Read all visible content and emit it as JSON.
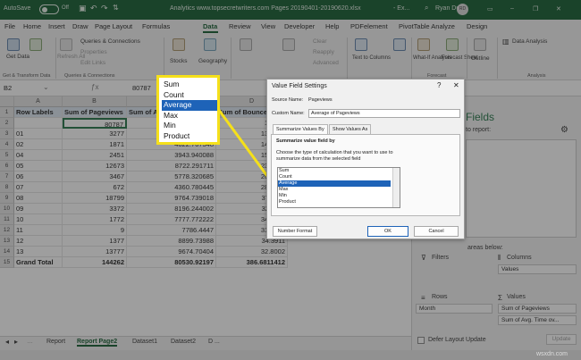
{
  "titlebar": {
    "autosave": "AutoSave",
    "toggle": "Off",
    "filename": "Analytics www.topsecretwriters.com Pages 20190401-20190620.xlsx",
    "suffix": "- Ex...",
    "user": "Ryan Dube",
    "initials": "RD"
  },
  "menu": [
    "File",
    "Home",
    "Insert",
    "Draw",
    "Page Layout",
    "Formulas",
    "Data",
    "Review",
    "View",
    "Developer",
    "Help",
    "PDFelement",
    "PivotTable Analyze",
    "Design"
  ],
  "ribbon": {
    "get_data": "Get Data",
    "refresh_all": "Refresh All",
    "queries_connections": "Queries & Connections",
    "properties": "Properties",
    "edit_links": "Edit Links",
    "stocks": "Stocks",
    "geography": "Geography",
    "clear": "Clear",
    "reapply": "Reapply",
    "advanced": "Advanced",
    "sort_filter": "Sort & Filter",
    "text_to_columns": "Text to Columns",
    "what_if": "What-If Analysis",
    "forecast_sheet": "Forecast Sheet",
    "outline": "Outline",
    "data_analysis": "Data Analysis",
    "group_get_transform": "Get & Transform Data",
    "group_queries": "Queries & Connections",
    "group_forecast": "Forecast",
    "group_analysis": "Analysis"
  },
  "formula_bar": {
    "name_box": "B2",
    "value": "80787"
  },
  "grid": {
    "columns": [
      "A",
      "B",
      "C",
      "D"
    ],
    "headers": [
      "Row Labels",
      "Sum of Pageviews",
      "Sum of A",
      "Sum of Bounce"
    ],
    "rows": [
      {
        "n": "2",
        "a": "",
        "b": "80787",
        "c": "",
        "d": "1.5578"
      },
      {
        "n": "3",
        "a": "01",
        "b": "3277",
        "c": "",
        "d": "13.5977"
      },
      {
        "n": "4",
        "a": "02",
        "b": "1871",
        "c": "4622.767348",
        "d": "14.6046"
      },
      {
        "n": "5",
        "a": "04",
        "b": "2451",
        "c": "3943.940088",
        "d": "15.3900"
      },
      {
        "n": "6",
        "a": "05",
        "b": "12673",
        "c": "8722.291711",
        "d": "23.7100"
      },
      {
        "n": "7",
        "a": "06",
        "b": "3467",
        "c": "5778.320685",
        "d": "26.0077"
      },
      {
        "n": "8",
        "a": "07",
        "b": "672",
        "c": "4360.780445",
        "d": "28.5510"
      },
      {
        "n": "9",
        "a": "08",
        "b": "18799",
        "c": "9764.739018",
        "d": "37.3911"
      },
      {
        "n": "10",
        "a": "09",
        "b": "3372",
        "c": "8196.244002",
        "d": "32.7811"
      },
      {
        "n": "11",
        "a": "10",
        "b": "1772",
        "c": "7777.772222",
        "d": "34.5822"
      },
      {
        "n": "12",
        "a": "11",
        "b": "9",
        "c": "7786.4447",
        "d": "31.6000"
      },
      {
        "n": "13",
        "a": "12",
        "b": "1377",
        "c": "8899.73988",
        "d": "34.3911"
      },
      {
        "n": "14",
        "a": "13",
        "b": "13777",
        "c": "9674.70404",
        "d": "32.8002"
      },
      {
        "n": "15",
        "a": "Grand Total",
        "b": "144262",
        "c": "80530.92197",
        "d": "386.6811412"
      }
    ]
  },
  "sheet_tabs": [
    "Report",
    "Report Page2",
    "Dataset1",
    "Dataset2",
    "D ..."
  ],
  "callout": {
    "items": [
      "Sum",
      "Count",
      "Average",
      "Max",
      "Min",
      "Product"
    ],
    "selected": "Average"
  },
  "dialog": {
    "title": "Value Field Settings",
    "source_label": "Source Name:",
    "source_value": "Pageviews",
    "custom_label": "Custom Name:",
    "custom_value": "Average of Pageviews",
    "tab1": "Summarize Values By",
    "tab2": "Show Values As",
    "section": "Summarize value field by",
    "desc": "Choose the type of calculation that you want to use to summarize data from the selected field",
    "list": [
      "Sum",
      "Count",
      "Average",
      "Max",
      "Min",
      "Product"
    ],
    "selected": "Average",
    "number_format": "Number Format",
    "ok": "OK",
    "cancel": "Cancel"
  },
  "pivot_pane": {
    "title": "Fields",
    "subtitle": "to report:",
    "areas_hint": "areas below:",
    "filters": "Filters",
    "columns": "Columns",
    "columns_value": "Values",
    "rows": "Rows",
    "rows_value": "Month",
    "values": "Values",
    "values_items": [
      "Sum of Pageviews",
      "Sum of Avg. Time ov..."
    ],
    "defer": "Defer Layout Update",
    "update": "Update"
  },
  "watermark": "wsxdn.com"
}
